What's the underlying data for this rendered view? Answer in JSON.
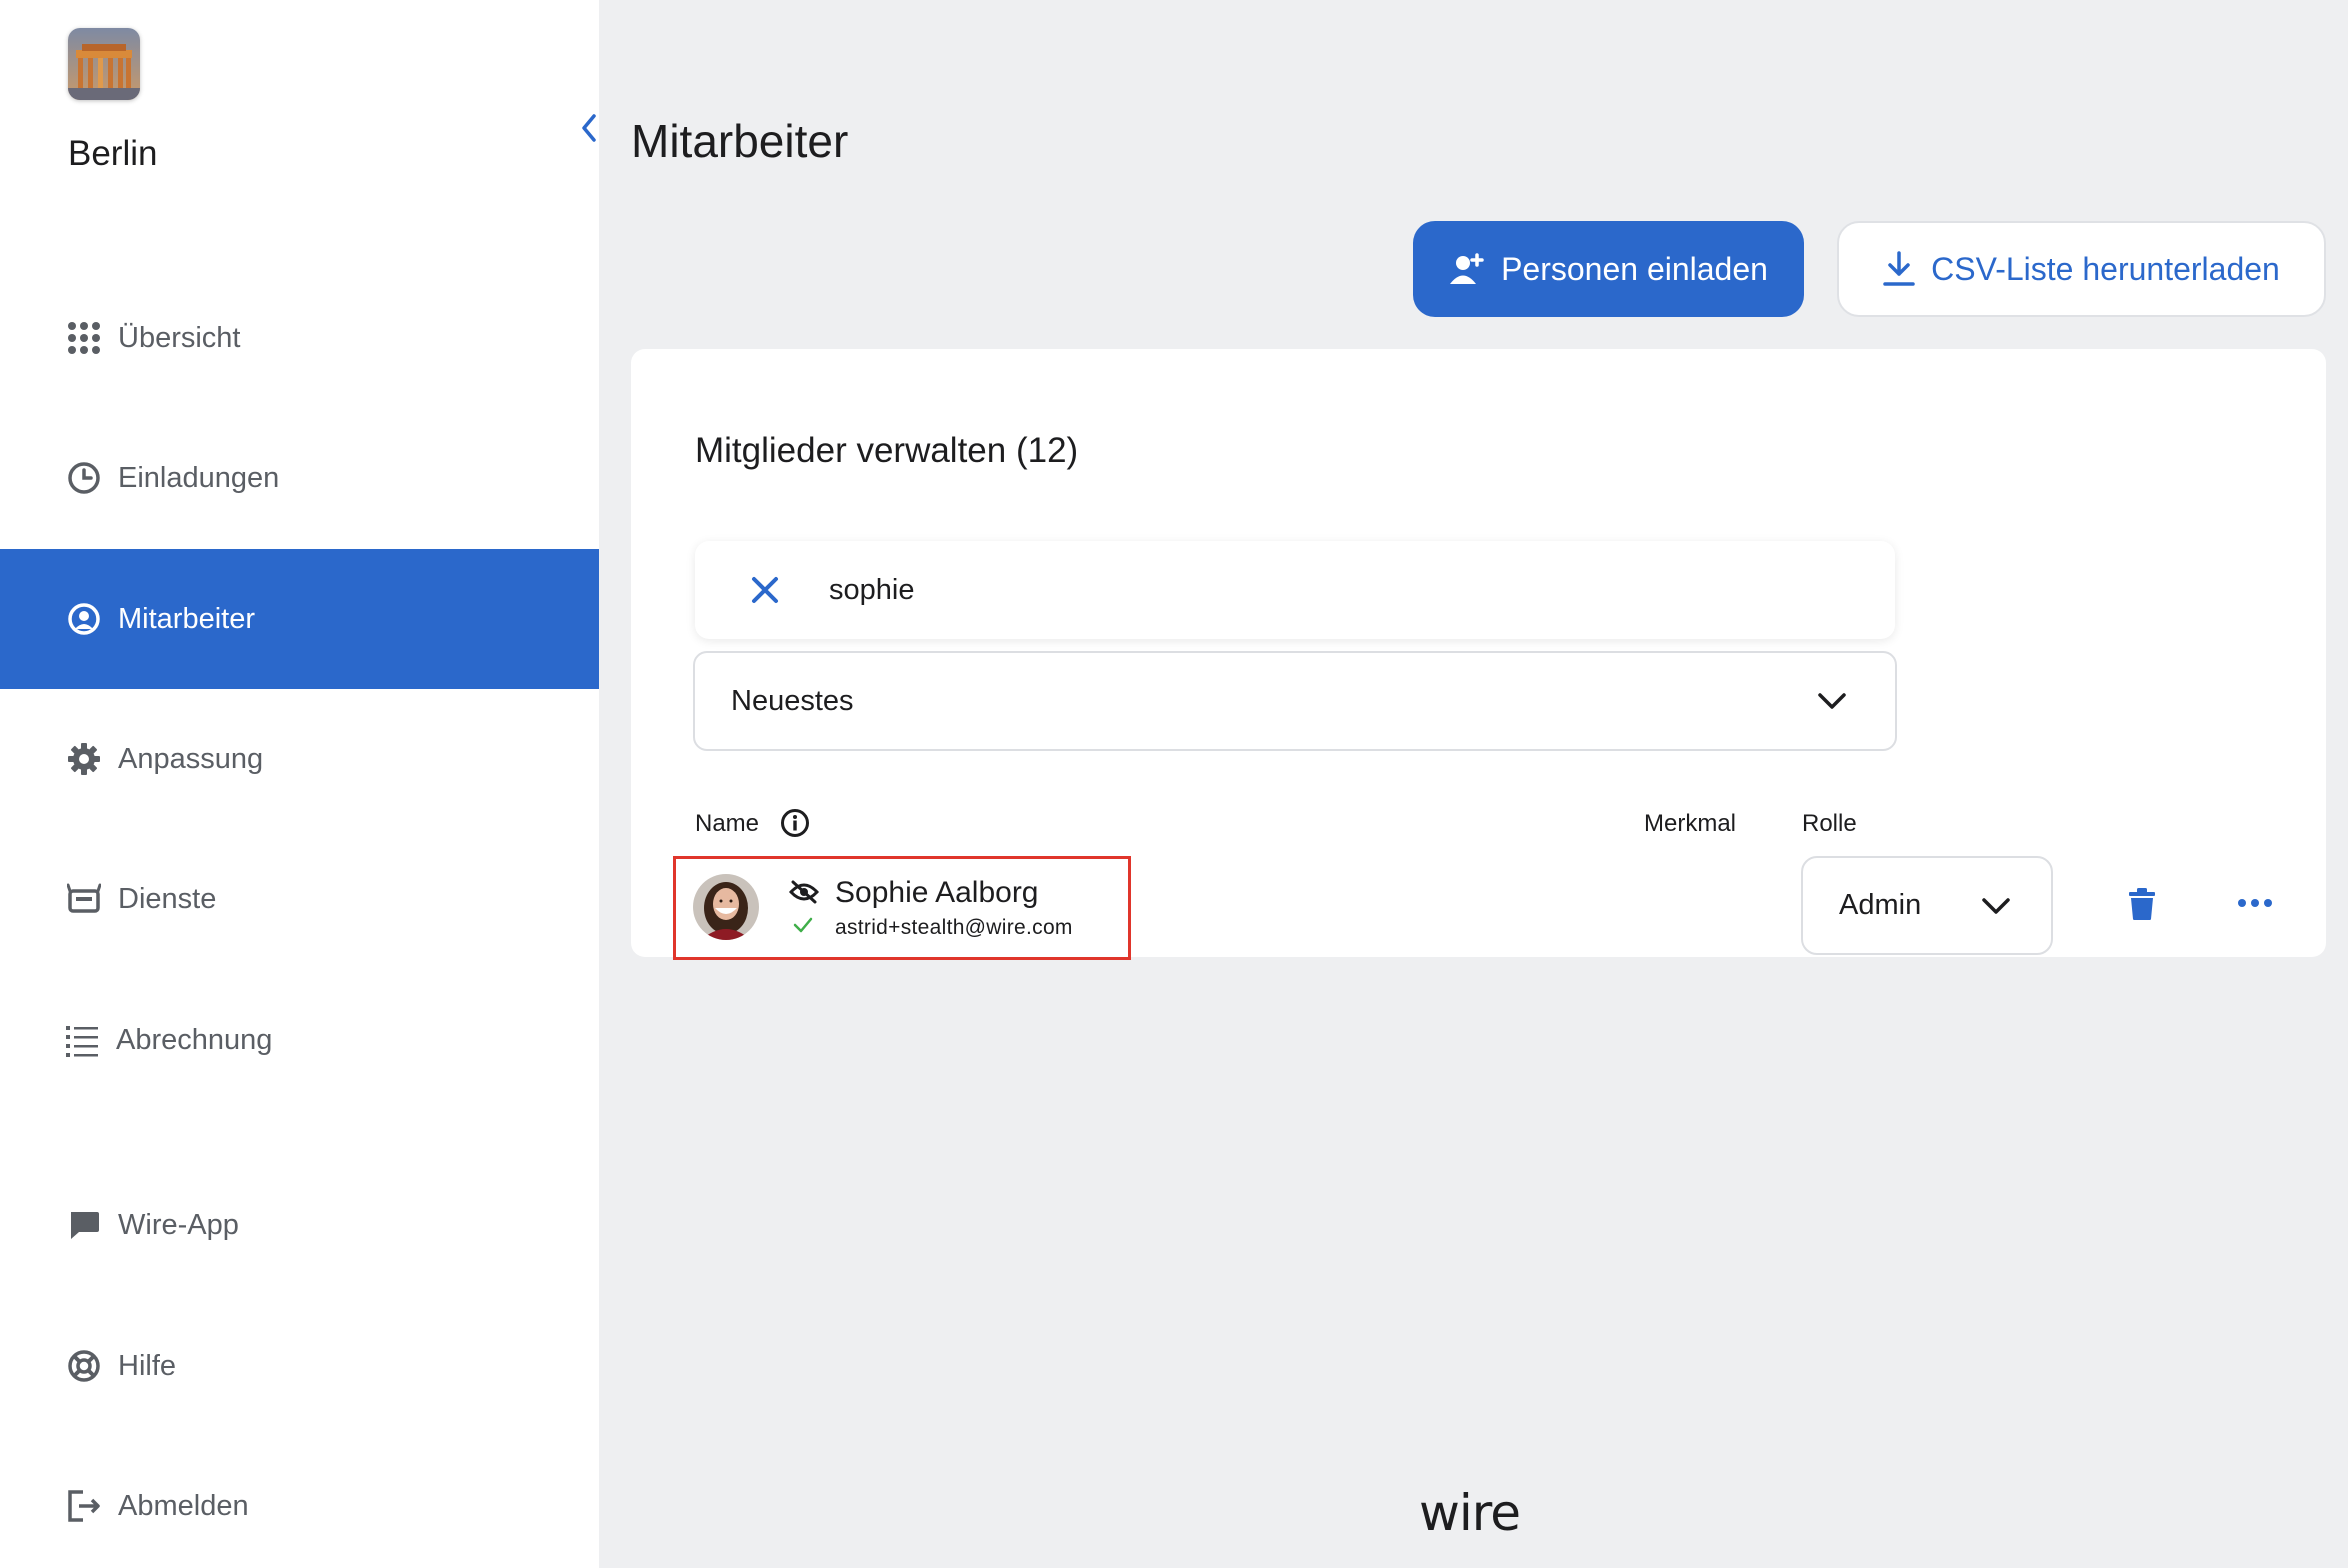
{
  "sidebar": {
    "team_name": "Berlin",
    "items": [
      {
        "label": "Übersicht",
        "icon": "grid-icon"
      },
      {
        "label": "Einladungen",
        "icon": "clock-icon"
      },
      {
        "label": "Mitarbeiter",
        "icon": "user-circle-icon",
        "active": true
      },
      {
        "label": "Anpassung",
        "icon": "gear-icon"
      },
      {
        "label": "Dienste",
        "icon": "bot-icon"
      },
      {
        "label": "Abrechnung",
        "icon": "list-icon"
      },
      {
        "label": "Wire-App",
        "icon": "chat-bubble-icon"
      },
      {
        "label": "Hilfe",
        "icon": "lifebuoy-icon"
      },
      {
        "label": "Abmelden",
        "icon": "logout-icon"
      }
    ]
  },
  "header": {
    "title": "Mitarbeiter",
    "invite_label": "Personen einladen",
    "csv_label": "CSV-Liste herunterladen"
  },
  "members": {
    "title": "Mitglieder verwalten (12)",
    "search_value": "sophie",
    "sort_selected": "Neuestes",
    "columns": {
      "name": "Name",
      "feature": "Merkmal",
      "role": "Rolle"
    },
    "rows": [
      {
        "name": "Sophie Aalborg",
        "email": "astrid+stealth@wire.com",
        "role": "Admin"
      }
    ]
  },
  "footer": {
    "logo_text": "wire"
  },
  "colors": {
    "accent": "#2b68cb",
    "highlight": "#e0352b",
    "verified": "#3fae49"
  }
}
